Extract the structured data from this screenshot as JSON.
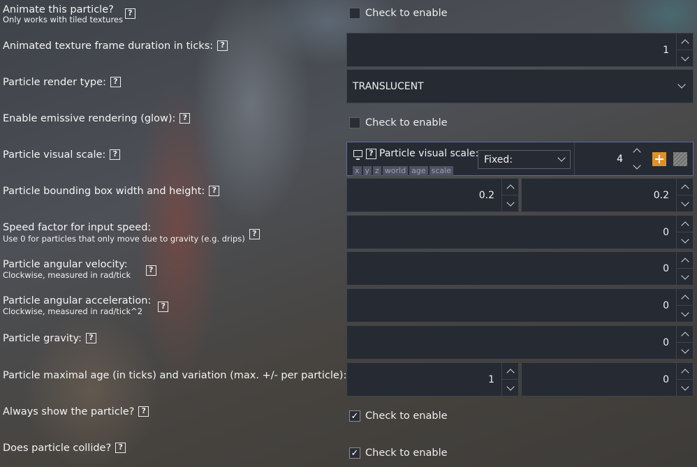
{
  "rows": {
    "animate": {
      "label": "Animate this particle?",
      "sub": "Only works with tiled textures",
      "checkbox_label": "Check to enable",
      "checked": false
    },
    "frame_duration": {
      "label": "Animated texture frame duration in ticks:",
      "value": "1"
    },
    "render_type": {
      "label": "Particle render type:",
      "value": "TRANSLUCENT"
    },
    "emissive": {
      "label": "Enable emissive rendering (glow):",
      "checkbox_label": "Check to enable",
      "checked": false
    },
    "visual_scale": {
      "label": "Particle visual scale:",
      "panel_label": "Particle visual scale:",
      "tags": [
        "x",
        "y",
        "z",
        "world",
        "age",
        "scale"
      ],
      "mode": "Fixed:",
      "value": "4",
      "add_icon": "plus-icon",
      "extra_icon": "texture-icon"
    },
    "bbox": {
      "label": "Particle bounding box width and height:",
      "width": "0.2",
      "height": "0.2"
    },
    "speed_factor": {
      "label": "Speed factor for input speed:",
      "sub": "Use 0 for particles that only move due to gravity (e.g. drips)",
      "value": "0"
    },
    "angular_velocity": {
      "label": "Particle angular velocity:",
      "sub": "Clockwise, measured in rad/tick",
      "value": "0"
    },
    "angular_accel": {
      "label": "Particle angular acceleration:",
      "sub": "Clockwise, measured in rad/tick^2",
      "value": "0"
    },
    "gravity": {
      "label": "Particle gravity:",
      "value": "0"
    },
    "max_age": {
      "label": "Particle maximal age (in ticks) and variation (max. +/- per particle):",
      "age": "1",
      "variation": "0"
    },
    "always_show": {
      "label": "Always show the particle?",
      "checkbox_label": "Check to enable",
      "checked": true
    },
    "collide": {
      "label": "Does particle collide?",
      "checkbox_label": "Check to enable",
      "checked": true
    }
  },
  "help_glyph": "?",
  "check_glyph": "✓",
  "colors": {
    "field_bg": "#262a33",
    "panel_border": "#5c6c9a",
    "add_button": "#e0902a"
  }
}
